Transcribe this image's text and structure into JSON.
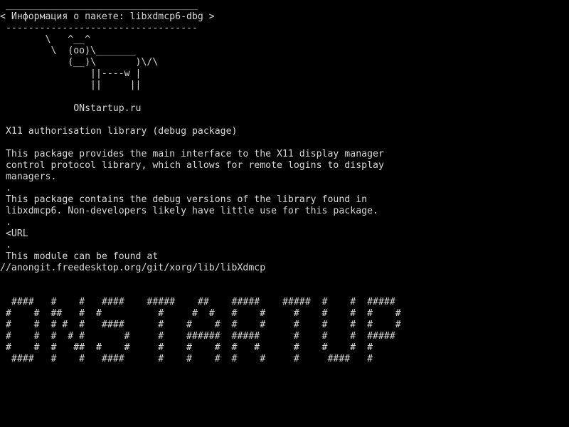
{
  "terminal": {
    "title": "Информация о пакете: libxdmcp6-dbg",
    "bubble": {
      "top_border": " __________________________________",
      "text": "< Информация о пакете: libxdmcp6-dbg >",
      "bottom_border": " ----------------------------------"
    },
    "cow": [
      "        \\   ^__^",
      "         \\  (oo)\\_______",
      "            (__)\\       )\\/\\",
      "                ||----w |",
      "                ||     ||"
    ],
    "site": "             ONstartup.ru",
    "description_lines": [
      " X11 authorisation library (debug package)",
      " This package provides the main interface to the X11 display manager",
      " control protocol library, which allows for remote logins to display",
      " managers.",
      " .",
      " This package contains the debug versions of the library found in",
      " libxdmcp6. Non-developers likely have little use for this package.",
      " .",
      " <URL",
      " .",
      " This module can be found at",
      "//anongit.freedesktop.org/git/xorg/lib/libXdmcp"
    ],
    "banner": [
      "  ####   #    #   ####    #####    ##    #####    #####  #    #  #####",
      " #    #  ##   #  #          #     #  #   #    #     #    #    #  #    #",
      " #    #  # #  #   ####      #    #    #  #    #     #    #    #  #    #",
      " #    #  #  # #       #     #    ######  #####      #    #    #  #####",
      " #    #  #   ##  #    #     #    #    #  #   #      #    #    #  #",
      "  ####   #    #   ####      #    #    #  #    #     #     ####   #"
    ],
    "colors": {
      "background": "#000000",
      "foreground": "#d8d8d8"
    }
  }
}
